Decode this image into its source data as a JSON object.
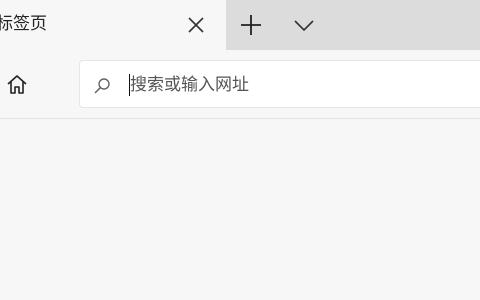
{
  "tab": {
    "title": "标签页",
    "close_icon": "close-icon"
  },
  "tabstrip": {
    "new_tab_icon": "plus-icon",
    "tab_actions_icon": "chevron-down-icon"
  },
  "toolbar": {
    "home_icon": "home-icon"
  },
  "address_bar": {
    "search_icon": "search-icon",
    "placeholder": "搜索或输入网址"
  },
  "colors": {
    "tabstrip_bg": "#dcdcdc",
    "active_tab_bg": "#f7f7f7",
    "address_bg": "#ffffff"
  }
}
